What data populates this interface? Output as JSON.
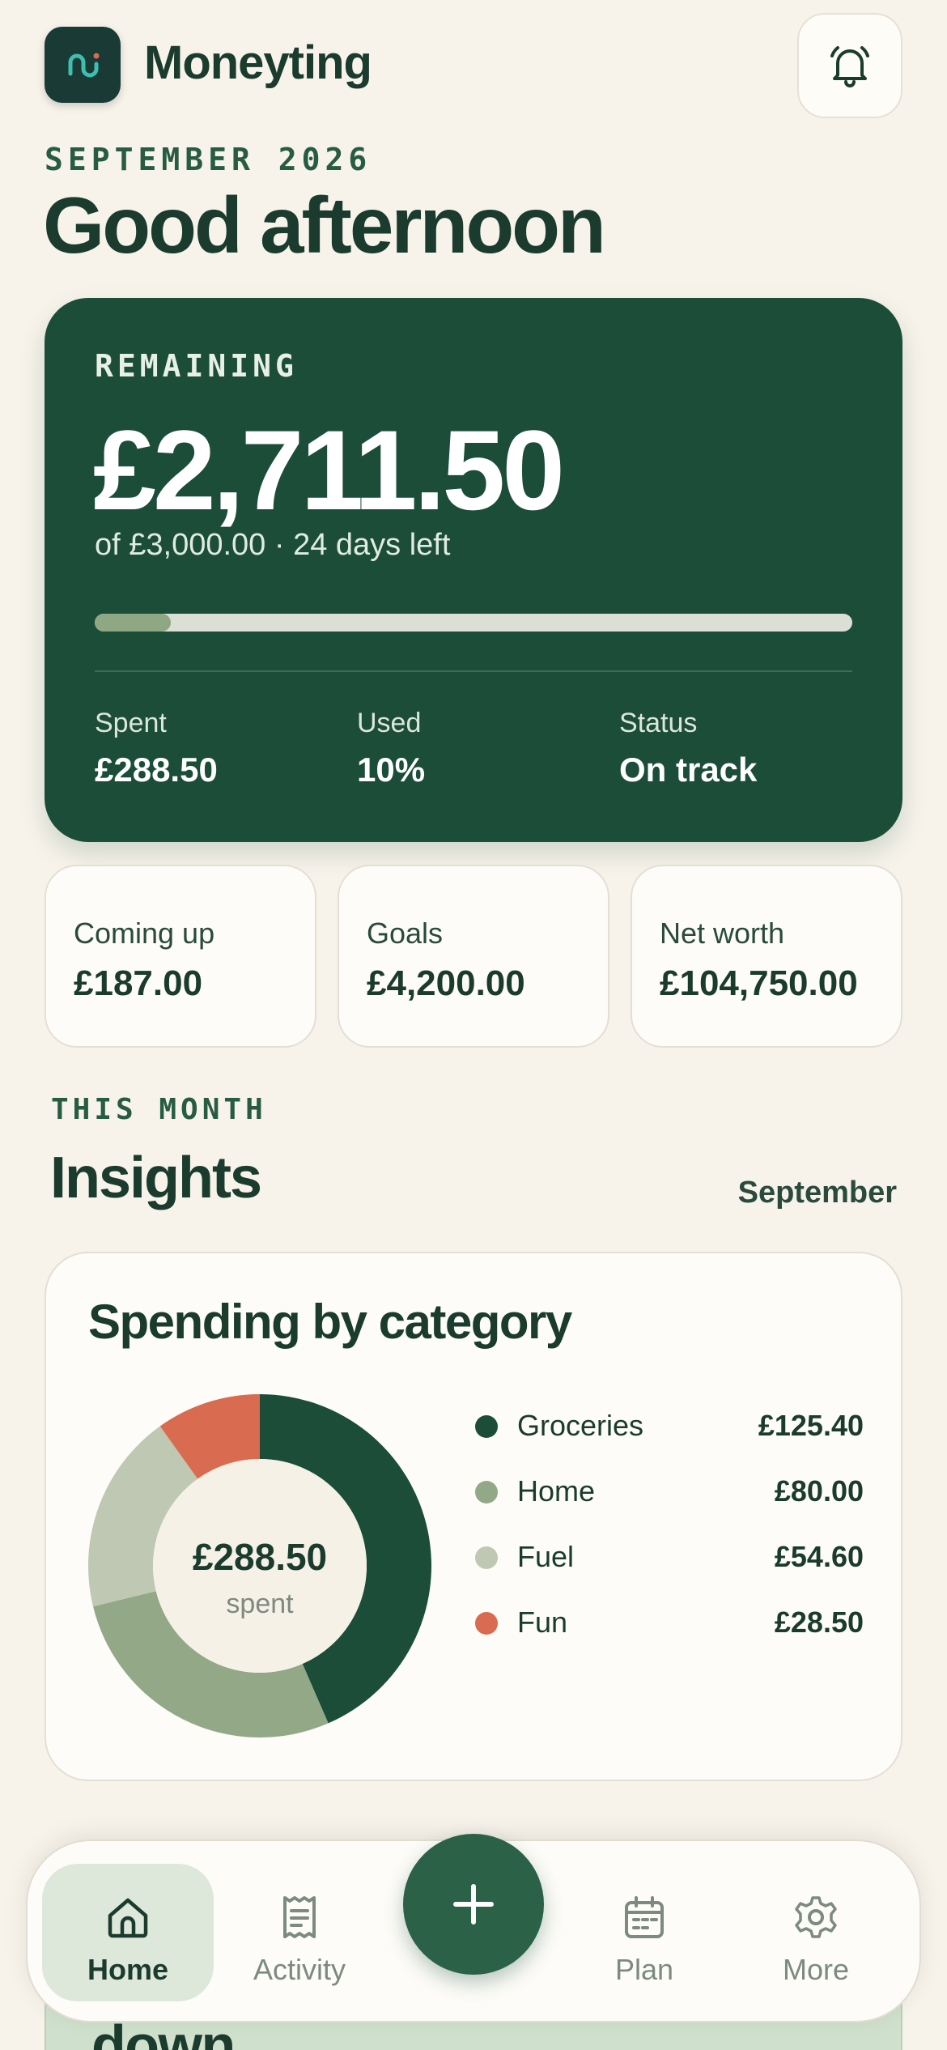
{
  "app": {
    "title": "Moneyting"
  },
  "header": {
    "month_label": "SEPTEMBER 2026",
    "greeting": "Good afternoon"
  },
  "hero": {
    "label": "REMAINING",
    "amount": "£2,711.50",
    "subtitle": "of £3,000.00 · 24 days left",
    "progress_fraction": 0.1,
    "stats": [
      {
        "label": "Spent",
        "value": "£288.50"
      },
      {
        "label": "Used",
        "value": "10%"
      },
      {
        "label": "Status",
        "value": "On track"
      }
    ]
  },
  "summary_cards": [
    {
      "label": "Coming up",
      "value": "£187.00"
    },
    {
      "label": "Goals",
      "value": "£4,200.00"
    },
    {
      "label": "Net worth",
      "value": "£104,750.00"
    }
  ],
  "insights": {
    "eyebrow": "THIS MONTH",
    "title": "Insights",
    "period_link": "September",
    "card_title": "Spending by category",
    "center_amount": "£288.50",
    "center_label": "spent",
    "categories": [
      {
        "name": "Groceries",
        "amount": "£125.40",
        "value": 125.4,
        "color": "#1b4d38"
      },
      {
        "name": "Home",
        "amount": "£80.00",
        "value": 80.0,
        "color": "#92a887"
      },
      {
        "name": "Fuel",
        "amount": "£54.60",
        "value": 54.6,
        "color": "#bec8b2"
      },
      {
        "name": "Fun",
        "amount": "£28.50",
        "value": 28.5,
        "color": "#d96b50"
      }
    ]
  },
  "next_section_peek": {
    "title": "down"
  },
  "tabbar": {
    "tabs": [
      {
        "label": "Home",
        "icon": "home-icon",
        "active": true
      },
      {
        "label": "Activity",
        "icon": "receipt-icon",
        "active": false
      },
      {
        "label": "Plan",
        "icon": "calendar-icon",
        "active": false
      },
      {
        "label": "More",
        "icon": "gear-icon",
        "active": false
      }
    ],
    "fab_icon": "plus-icon"
  },
  "colors": {
    "background": "#f7f3ea",
    "primary": "#1b4d38",
    "accent": "#2a6147",
    "danger_accent": "#d96b50",
    "logo_glyph": "#3fbfb0"
  }
}
